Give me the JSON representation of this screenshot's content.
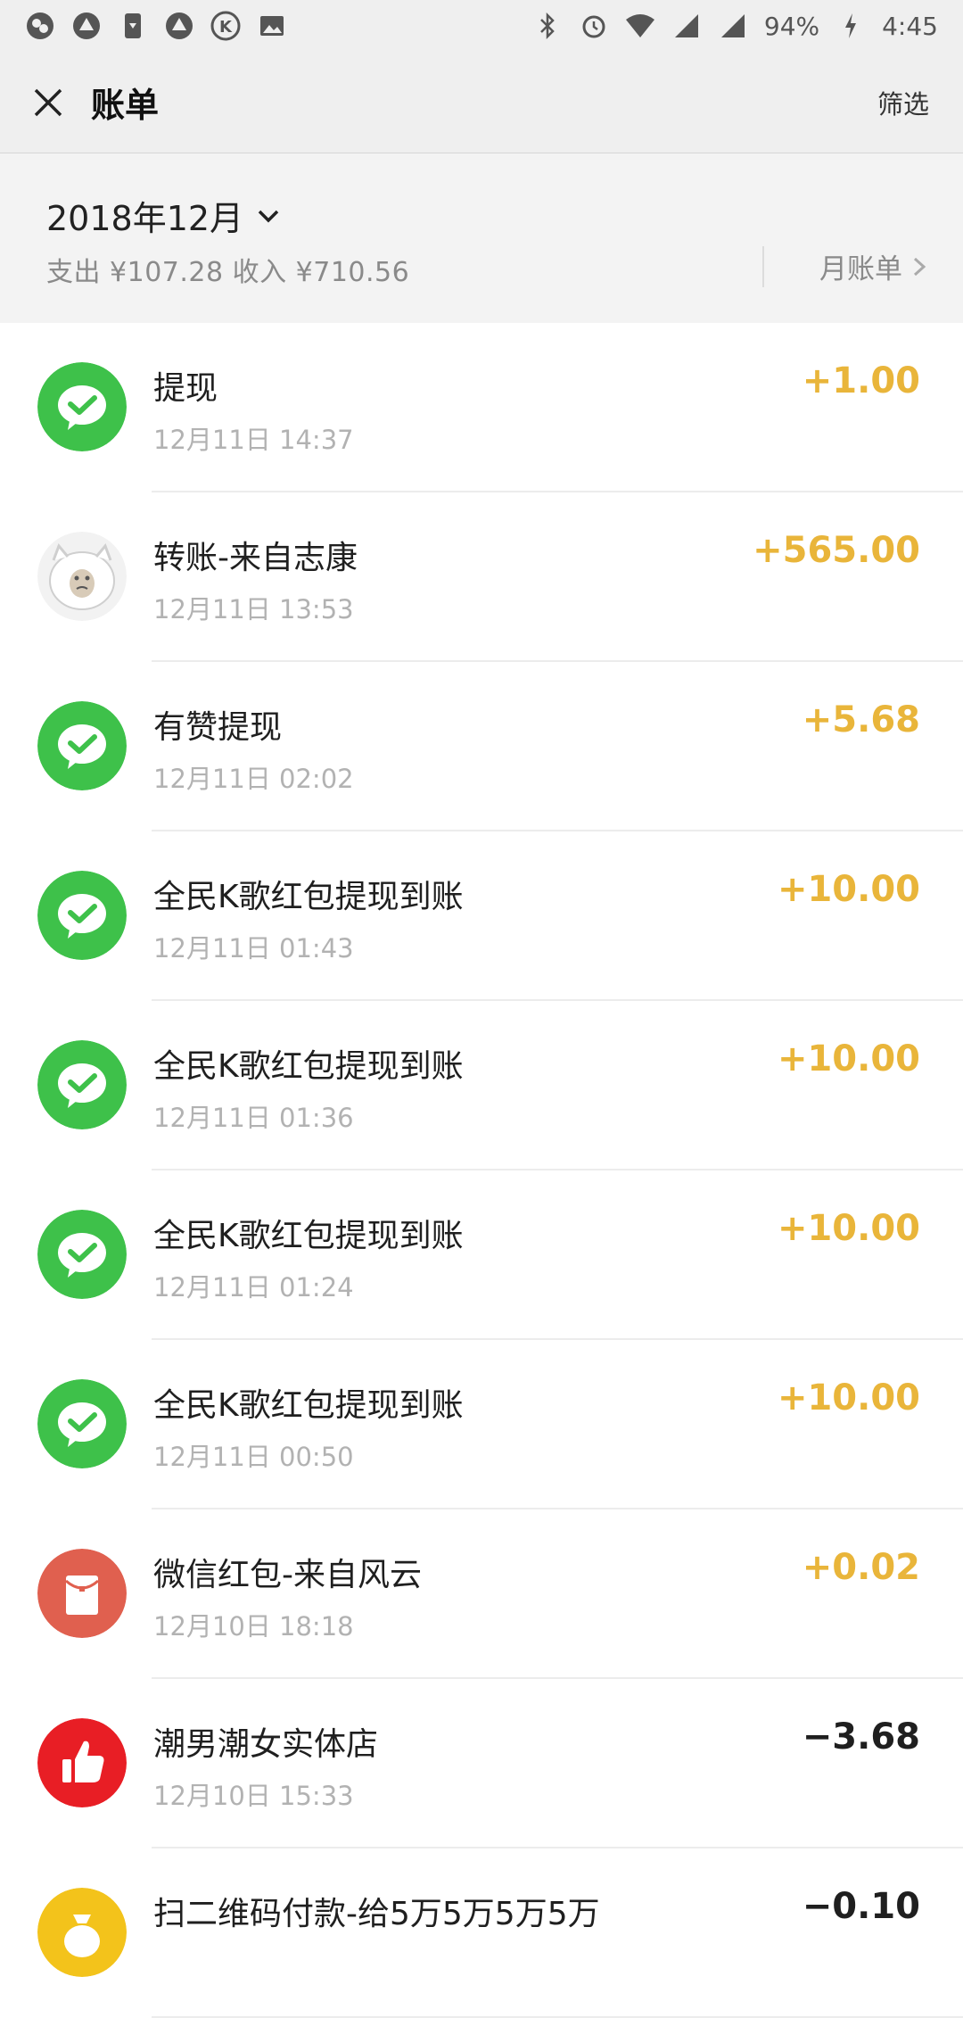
{
  "status_bar": {
    "battery": "94%",
    "time": "4:45",
    "left_icons": [
      "app-notification-icon",
      "app-notification-icon",
      "download-icon",
      "app-notification-icon",
      "k-app-icon",
      "image-icon"
    ],
    "right_icons": [
      "bluetooth-icon",
      "alarm-icon",
      "wifi-icon",
      "signal-icon",
      "signal-icon",
      "charging-icon"
    ]
  },
  "nav": {
    "title": "账单",
    "filter_label": "筛选"
  },
  "month_header": {
    "month_label": "2018年12月",
    "summary": "支出 ¥107.28 收入 ¥710.56",
    "monthly_bill_label": "月账单"
  },
  "colors": {
    "income": "#e9b53a",
    "wechat_green": "#3ec14a",
    "red_packet": "#e0604f",
    "thumb_red": "#e81e25",
    "yellow": "#f3c31b"
  },
  "transactions": [
    {
      "title": "提现",
      "time": "12月11日 14:37",
      "amount": "+1.00",
      "type": "income",
      "icon": "wechat-pay-icon"
    },
    {
      "title": "转账-来自志康",
      "time": "12月11日 13:53",
      "amount": "+565.00",
      "type": "income",
      "icon": "user-avatar"
    },
    {
      "title": "有赞提现",
      "time": "12月11日 02:02",
      "amount": "+5.68",
      "type": "income",
      "icon": "wechat-pay-icon"
    },
    {
      "title": "全民K歌红包提现到账",
      "time": "12月11日 01:43",
      "amount": "+10.00",
      "type": "income",
      "icon": "wechat-pay-icon"
    },
    {
      "title": "全民K歌红包提现到账",
      "time": "12月11日 01:36",
      "amount": "+10.00",
      "type": "income",
      "icon": "wechat-pay-icon"
    },
    {
      "title": "全民K歌红包提现到账",
      "time": "12月11日 01:24",
      "amount": "+10.00",
      "type": "income",
      "icon": "wechat-pay-icon"
    },
    {
      "title": "全民K歌红包提现到账",
      "time": "12月11日 00:50",
      "amount": "+10.00",
      "type": "income",
      "icon": "wechat-pay-icon"
    },
    {
      "title": "微信红包-来自风云",
      "time": "12月10日 18:18",
      "amount": "+0.02",
      "type": "income",
      "icon": "red-packet-icon"
    },
    {
      "title": "潮男潮女实体店",
      "time": "12月10日 15:33",
      "amount": "−3.68",
      "type": "expense",
      "icon": "thumbs-up-icon"
    },
    {
      "title": "扫二维码付款-给5万5万5万5万",
      "time": "",
      "amount": "−0.10",
      "type": "expense",
      "icon": "money-bag-icon"
    }
  ]
}
